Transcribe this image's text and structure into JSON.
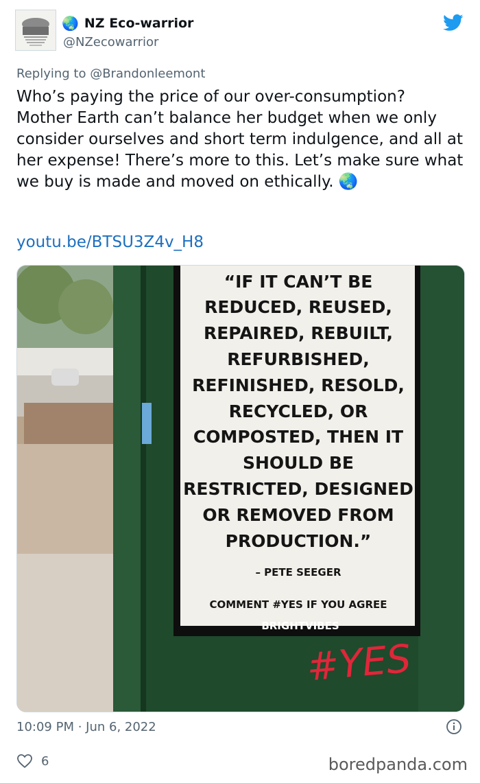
{
  "author": {
    "name": "NZ Eco-warrior",
    "handle": "@NZecowarrior",
    "emoji": "🌏"
  },
  "reply": {
    "prefix": "Replying to ",
    "to": "@Brandonleemont"
  },
  "tweet": {
    "text": "Who’s paying the price of our over-consumption? Mother Earth can’t balance her budget when we only consider ourselves and short term indulgence, and all at her expense! There’s more to this. Let’s make sure what we buy is made and moved on ethically. 🌏",
    "link": "youtu.be/BTSU3Z4v_H8"
  },
  "poster": {
    "quote": [
      "“IF IT CAN’T BE",
      "REDUCED, REUSED,",
      "REPAIRED, REBUILT,",
      "REFURBISHED,",
      "REFINISHED, RESOLD,",
      "RECYCLED, OR",
      "COMPOSTED, THEN IT",
      "SHOULD BE",
      "RESTRICTED, DESIGNED",
      "OR REMOVED FROM",
      "PRODUCTION.”"
    ],
    "attribution": "– PETE SEEGER",
    "cta": "COMMENT #YES IF YOU AGREE",
    "brand": "BRIGHTVIBES",
    "graffiti": "#YES"
  },
  "meta": {
    "time": "10:09 PM",
    "sep": " · ",
    "date": "Jun 6, 2022"
  },
  "likes": {
    "count": "6"
  },
  "watermark": "boredpanda.com",
  "colors": {
    "link": "#1d6fbf",
    "muted": "#536471",
    "twitter_blue": "#1d9bf0",
    "cabinet_green": "#1f4a2c",
    "graffiti_red": "#e0263a"
  }
}
